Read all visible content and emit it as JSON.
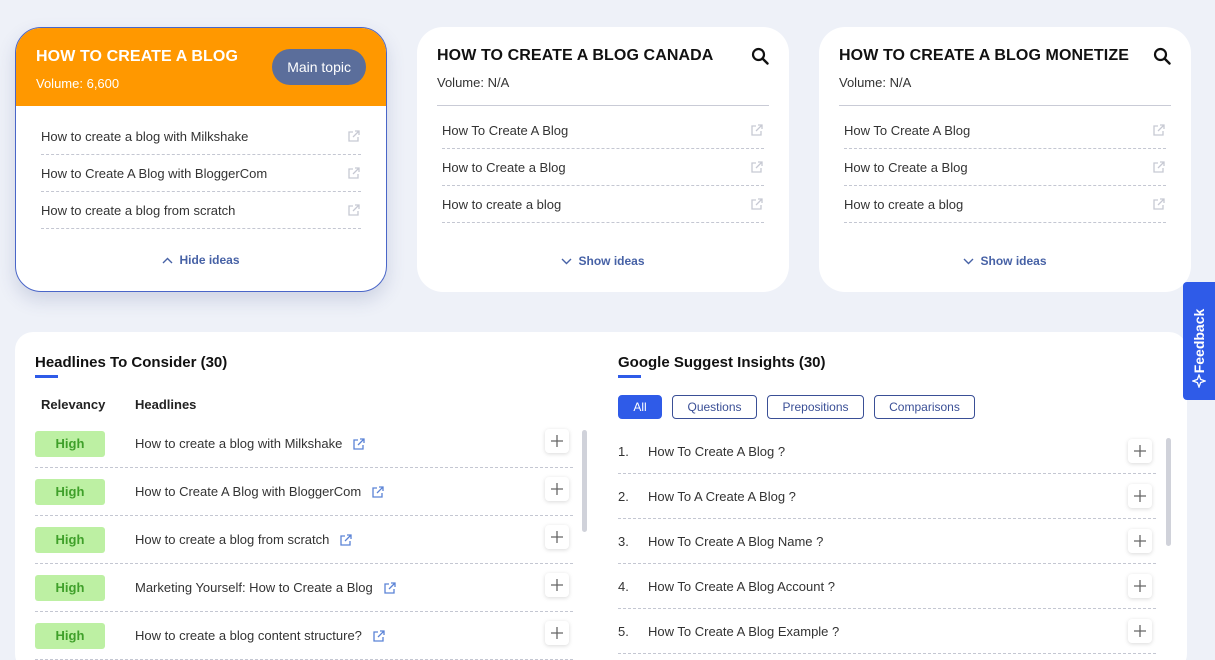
{
  "topic_cards": [
    {
      "title": "HOW TO CREATE A BLOG",
      "volume": "Volume: 6,600",
      "badge_label": "Main topic",
      "ideas": [
        "How to create a blog with Milkshake",
        "How to Create A Blog with BloggerCom",
        "How to create a blog from scratch"
      ],
      "toggle_label": "Hide ideas"
    },
    {
      "title": "HOW TO CREATE A BLOG CANADA",
      "volume": "Volume: N/A",
      "ideas": [
        "How To Create A Blog",
        "How to Create a Blog",
        "How to create a blog"
      ],
      "toggle_label": "Show ideas"
    },
    {
      "title": "HOW TO CREATE A BLOG MONETIZE",
      "volume": "Volume: N/A",
      "ideas": [
        "How To Create A Blog",
        "How to Create a Blog",
        "How to create a blog"
      ],
      "toggle_label": "Show ideas"
    }
  ],
  "headlines": {
    "title": "Headlines To Consider (30)",
    "col_relevancy": "Relevancy",
    "col_headlines": "Headlines",
    "rows": [
      {
        "relevancy": "High",
        "text": "How to create a blog with Milkshake"
      },
      {
        "relevancy": "High",
        "text": "How to Create A Blog with BloggerCom"
      },
      {
        "relevancy": "High",
        "text": "How to create a blog from scratch"
      },
      {
        "relevancy": "High",
        "text": "Marketing Yourself: How to Create a Blog"
      },
      {
        "relevancy": "High",
        "text": "How to create a blog content structure?"
      }
    ]
  },
  "google_suggest": {
    "title": "Google Suggest Insights (30)",
    "filters": [
      "All",
      "Questions",
      "Prepositions",
      "Comparisons"
    ],
    "active_filter": "All",
    "rows": [
      {
        "num": "1.",
        "text": "How To Create A Blog ?"
      },
      {
        "num": "2.",
        "text": "How To A Create A Blog ?"
      },
      {
        "num": "3.",
        "text": "How To Create A Blog Name ?"
      },
      {
        "num": "4.",
        "text": "How To Create A Blog Account ?"
      },
      {
        "num": "5.",
        "text": "How To Create A Blog Example ?"
      }
    ]
  },
  "feedback_label": "Feedback",
  "colors": {
    "main_accent": "#ff9800",
    "primary_blue": "#2f5be8",
    "badge_green_bg": "#bdf0a3",
    "badge_green_text": "#3fa02a"
  }
}
